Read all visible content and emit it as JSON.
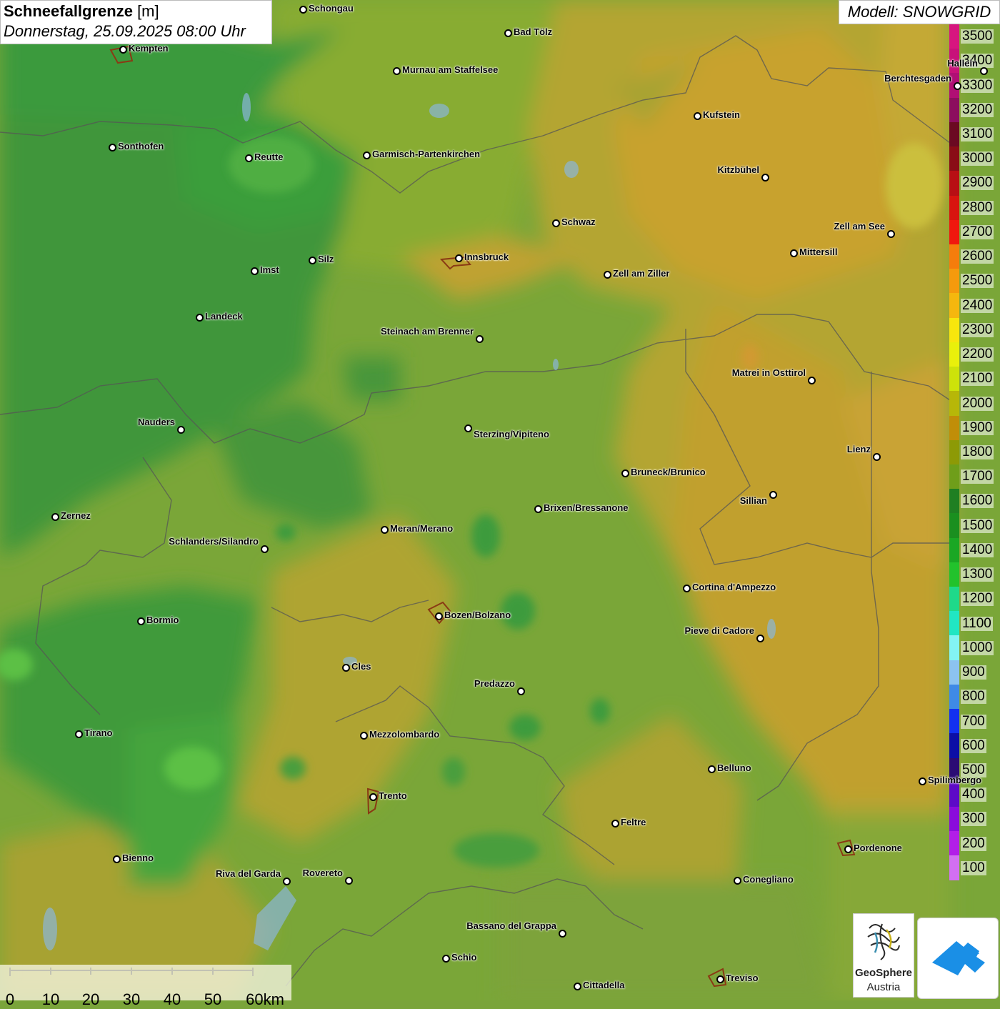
{
  "header": {
    "title_bold": "Schneefallgrenze",
    "title_unit": " [m]",
    "subtitle": "Donnerstag, 25.09.2025 08:00 Uhr"
  },
  "model": "Modell: SNOWGRID",
  "legend": {
    "labels": [
      "3500",
      "3400",
      "3300",
      "3200",
      "3100",
      "3000",
      "2900",
      "2800",
      "2700",
      "2600",
      "2500",
      "2400",
      "2300",
      "2200",
      "2100",
      "2000",
      "1900",
      "1800",
      "1700",
      "1600",
      "1500",
      "1400",
      "1300",
      "1200",
      "1100",
      "1000",
      "900",
      "800",
      "700",
      "600",
      "500",
      "400",
      "300",
      "200",
      "100"
    ],
    "colors": [
      "#d7167f",
      "#c8127a",
      "#b00f74",
      "#8c0e5e",
      "#6b0a22",
      "#8a0d16",
      "#b80f14",
      "#d8150f",
      "#f0180e",
      "#f57d0c",
      "#f59a0d",
      "#f5b70e",
      "#f8e60d",
      "#e9f00b",
      "#cde20a",
      "#b7b708",
      "#c08e08",
      "#8d9a06",
      "#6f9e1a",
      "#1f7f22",
      "#1a8f1f",
      "#1aa724",
      "#22c22c",
      "#1fd98a",
      "#21e6c3",
      "#83f4f4",
      "#8cc3f0",
      "#3f8ae6",
      "#1230f0",
      "#0c0fa6",
      "#2b0c74",
      "#5d0ac7",
      "#8a0cdb",
      "#b21ee8",
      "#d26ff2"
    ]
  },
  "cities": [
    {
      "name": "Schongau"
    },
    {
      "name": "Bad Tölz"
    },
    {
      "name": "Kempten"
    },
    {
      "name": "Murnau am Staffelsee"
    },
    {
      "name": "Berchtesgaden"
    },
    {
      "name": "Kufstein"
    },
    {
      "name": "Sonthofen"
    },
    {
      "name": "Reutte"
    },
    {
      "name": "Garmisch-Partenkirchen"
    },
    {
      "name": "Kitzbühel"
    },
    {
      "name": "Schwaz"
    },
    {
      "name": "Zell am See"
    },
    {
      "name": "Mittersill"
    },
    {
      "name": "Innsbruck"
    },
    {
      "name": "Silz"
    },
    {
      "name": "Imst"
    },
    {
      "name": "Zell am Ziller"
    },
    {
      "name": "Landeck"
    },
    {
      "name": "Steinach am Brenner"
    },
    {
      "name": "Matrei in Osttirol"
    },
    {
      "name": "Nauders"
    },
    {
      "name": "Sterzing/Vipiteno"
    },
    {
      "name": "Lienz"
    },
    {
      "name": "Bruneck/Brunico"
    },
    {
      "name": "Sillian"
    },
    {
      "name": "Zernez"
    },
    {
      "name": "Brixen/Bressanone"
    },
    {
      "name": "Meran/Merano"
    },
    {
      "name": "Schlanders/Silandro"
    },
    {
      "name": "Cortina d'Ampezzo"
    },
    {
      "name": "Bozen/Bolzano"
    },
    {
      "name": "Bormio"
    },
    {
      "name": "Pieve di Cadore"
    },
    {
      "name": "Cles"
    },
    {
      "name": "Predazzo"
    },
    {
      "name": "Tirano"
    },
    {
      "name": "Mezzolombardo"
    },
    {
      "name": "Belluno"
    },
    {
      "name": "Spilimbergo"
    },
    {
      "name": "Trento"
    },
    {
      "name": "Feltre"
    },
    {
      "name": "Pordenone"
    },
    {
      "name": "Bienno"
    },
    {
      "name": "Riva del Garda"
    },
    {
      "name": "Rovereto"
    },
    {
      "name": "Conegliano"
    },
    {
      "name": "Bassano del Grappa"
    },
    {
      "name": "Schio"
    },
    {
      "name": "Treviso"
    },
    {
      "name": "Cittadella"
    },
    {
      "name": "Hallein"
    }
  ],
  "scale": {
    "ticks": [
      "0",
      "10",
      "20",
      "30",
      "40",
      "50",
      "60km"
    ]
  },
  "logos": {
    "geosphere_line1": "GeoSphere",
    "geosphere_line2": "Austria"
  }
}
